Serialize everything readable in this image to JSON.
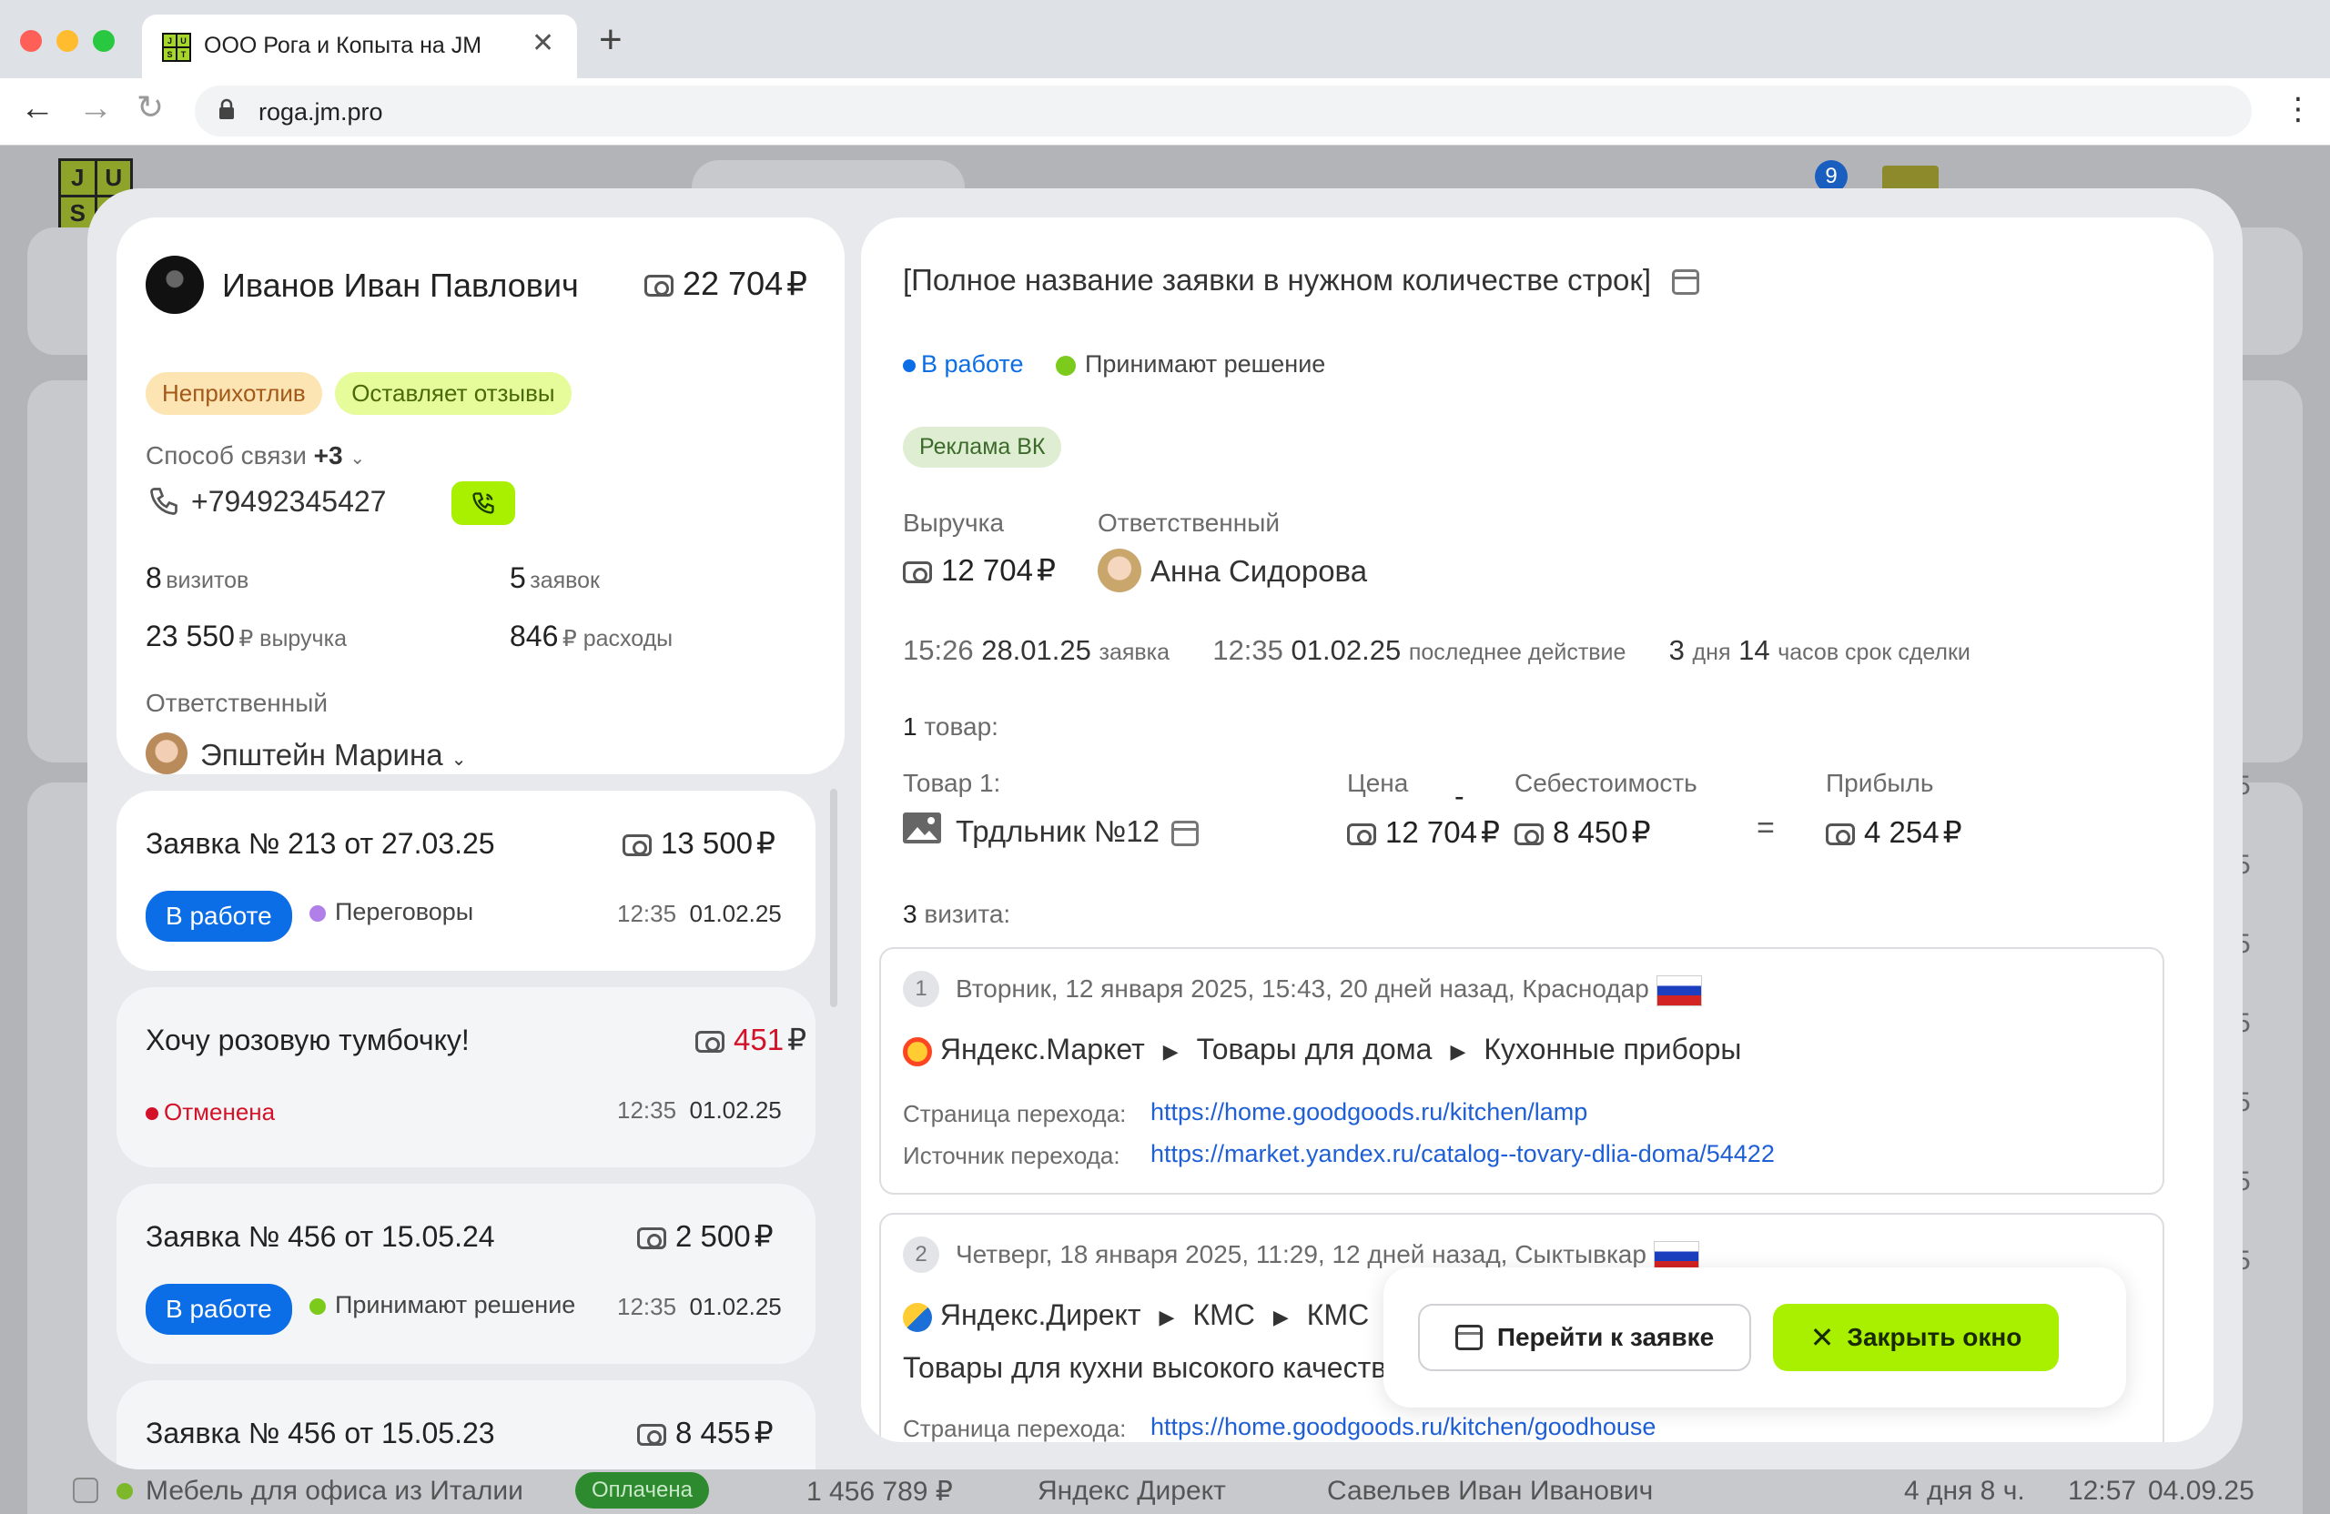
{
  "browser": {
    "tab_title": "ООО Рога и Копыта на JM",
    "url": "roga.jm.pro",
    "favicon_letters": [
      "J",
      "U",
      "S",
      "T"
    ]
  },
  "background": {
    "logo": [
      "J",
      "U",
      "S"
    ],
    "badge_count": "9",
    "row": {
      "name": "Мебель для офиса из Италии",
      "status": "Оплачена",
      "amount": "1 456 789 ₽",
      "source": "Яндекс Директ",
      "person": "Савельев Иван Иванович",
      "duration": "4 дня 8 ч.",
      "time": "12:57",
      "date": "04.09.25"
    },
    "right_edge_digits": [
      "5",
      "5",
      "5",
      "5",
      "5",
      "5",
      "5"
    ]
  },
  "client": {
    "name": "Иванов Иван Павлович",
    "balance": "22 704",
    "currency": "₽",
    "tags": [
      "Неприхотлив",
      "Оставляет отзывы"
    ],
    "contact_label": "Способ связи",
    "contact_more": "+3",
    "phone": "+79492345427",
    "visits_num": "8",
    "visits_label": "визитов",
    "orders_num": "5",
    "orders_label": "заявок",
    "revenue_num": "23 550",
    "revenue_label": "₽ выручка",
    "expenses_num": "846",
    "expenses_label": "₽ расходы",
    "responsible_label": "Ответственный",
    "responsible_name": "Эпштейн Марина"
  },
  "orders": [
    {
      "title": "Заявка № 213 от 27.03.25",
      "amount": "13 500",
      "status": "В работе",
      "stage": "Переговоры",
      "time": "12:35",
      "date": "01.02.25"
    },
    {
      "title": "Хочу розовую тумбочку!",
      "amount": "451",
      "status": "Отменена",
      "time": "12:35",
      "date": "01.02.25"
    },
    {
      "title": "Заявка № 456 от 15.05.24",
      "amount": "2 500",
      "status": "В работе",
      "stage": "Принимают решение",
      "time": "12:35",
      "date": "01.02.25"
    },
    {
      "title": "Заявка № 456 от 15.05.23",
      "amount": "8 455"
    }
  ],
  "deal": {
    "title": "[Полное название заявки в нужном количестве строк]",
    "status": "В работе",
    "stage": "Принимают решение",
    "tag": "Реклама ВК",
    "revenue_label": "Выручка",
    "revenue": "12 704",
    "responsible_label": "Ответственный",
    "responsible": "Анна Сидорова",
    "created_time": "15:26",
    "created_date": "28.01.25",
    "created_label": "заявка",
    "last_time": "12:35",
    "last_date": "01.02.25",
    "last_label": "последнее действие",
    "term_days": "3",
    "term_days_label": "дня",
    "term_hours": "14",
    "term_hours_label": "часов срок сделки",
    "goods_count": "1",
    "goods_label": "товар:",
    "item_label": "Товар 1:",
    "item_name": "Трдльник №12",
    "price_label": "Цена",
    "price": "12 704",
    "cost_label": "Себестоимость",
    "cost": "8 450",
    "profit_label": "Прибыль",
    "profit": "4 254",
    "minus": "-",
    "equals": "=",
    "visits_count": "3",
    "visits_label": "визита:"
  },
  "visits": [
    {
      "n": "1",
      "text": "Вторник, 12 января 2025, 15:43, 20 дней назад, Краснодар",
      "path": [
        "Яндекс.Маркет",
        "Товары для дома",
        "Кухонные приборы"
      ],
      "page_label": "Страница перехода:",
      "page_url": "https://home.goodgoods.ru/kitchen/lamp",
      "source_label": "Источник перехода:",
      "source_url": "https://market.yandex.ru/catalog--tovary-dlia-doma/54422"
    },
    {
      "n": "2",
      "text": "Четверг, 18 января 2025, 11:29, 12 дней назад, Сыктывкар",
      "path": [
        "Яндекс.Директ",
        "КМС",
        "КМС"
      ],
      "desc": "Товары для кухни высокого качества",
      "page_label": "Страница перехода:",
      "page_url": "https://home.goodgoods.ru/kitchen/goodhouse"
    }
  ],
  "actions": {
    "goto": "Перейти к заявке",
    "close": "Закрыть окно"
  },
  "colors": {
    "accent_green": "#a8f000",
    "blue": "#0b6ee6",
    "red": "#d3122a",
    "purple": "#b07fe8",
    "green_dot": "#7ccb1c"
  }
}
